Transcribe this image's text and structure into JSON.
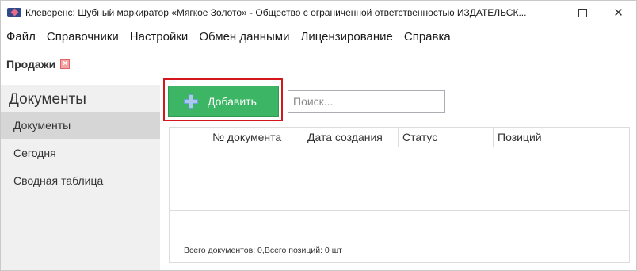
{
  "window": {
    "title": "Клеверенс: Шубный маркиратор «Мягкое Золото» - Общество с ограниченной ответственностью ИЗДАТЕЛЬСК..."
  },
  "menu": {
    "items": [
      "Файл",
      "Справочники",
      "Настройки",
      "Обмен данными",
      "Лицензирование",
      "Справка"
    ]
  },
  "page": {
    "title": "Продажи"
  },
  "sidebar": {
    "header": "Документы",
    "items": [
      {
        "label": "Документы",
        "active": true
      },
      {
        "label": "Сегодня",
        "active": false
      },
      {
        "label": "Сводная таблица",
        "active": false
      }
    ]
  },
  "toolbar": {
    "add_label": "Добавить",
    "search_placeholder": "Поиск..."
  },
  "table": {
    "columns": [
      "",
      "№ документа",
      "Дата создания",
      "Статус",
      "Позиций",
      ""
    ],
    "rows": [],
    "footer": "Всего документов: 0,Всего позиций: 0 шт"
  },
  "colors": {
    "add_button": "#3cb665",
    "highlight": "#d4161d",
    "sidebar_bg": "#f0f0f0",
    "sidebar_active": "#d6d6d6"
  },
  "icons": {
    "app": "app-heart-icon",
    "page_close": "close-icon",
    "add": "plus-icon"
  }
}
